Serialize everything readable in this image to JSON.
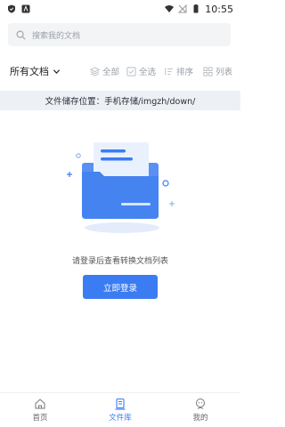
{
  "status_bar": {
    "time": "10:55"
  },
  "search": {
    "placeholder": "搜索我的文档"
  },
  "toolbar": {
    "folder_label": "所有文档",
    "all_label": "全部",
    "select_all_label": "全选",
    "sort_label": "排序",
    "list_label": "列表"
  },
  "path_banner": {
    "text": "文件储存位置：手机存储/imgzh/down/"
  },
  "empty_state": {
    "hint": "请登录后查看转换文档列表",
    "login_button": "立即登录"
  },
  "bottom_nav": {
    "items": [
      {
        "label": "首页",
        "icon": "home-icon",
        "active": false
      },
      {
        "label": "文件库",
        "icon": "document-library-icon",
        "active": true
      },
      {
        "label": "我的",
        "icon": "profile-icon",
        "active": false
      }
    ]
  },
  "colors": {
    "accent": "#3b7cf2",
    "banner_bg": "#edf1f6",
    "search_bg": "#f3f4f6"
  }
}
